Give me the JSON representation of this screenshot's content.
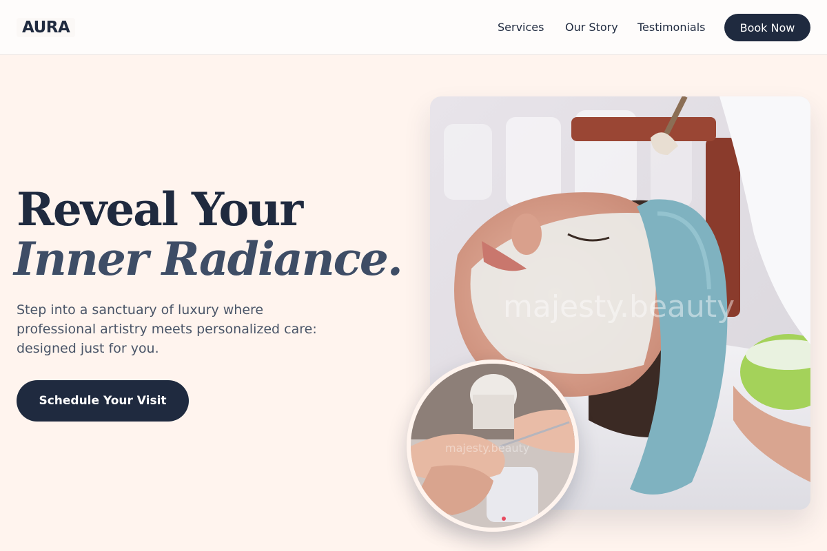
{
  "nav": {
    "logo": "AURA",
    "links": [
      "Services",
      "Our Story",
      "Testimonials"
    ],
    "book_label": "Book Now"
  },
  "hero": {
    "headline_line1": "Reveal Your",
    "headline_line2": "Inner Radiance.",
    "subtitle": "Step into a sanctuary of luxury where professional artistry meets personalized care: designed just for you.",
    "cta_label": "Schedule Your Visit"
  },
  "images": {
    "main_watermark": "majesty.beauty",
    "circle_watermark": "majesty.beauty"
  },
  "colors": {
    "background": "#fff4ee",
    "primary": "#1f2a3f",
    "accent_text": "#3e4d66"
  }
}
